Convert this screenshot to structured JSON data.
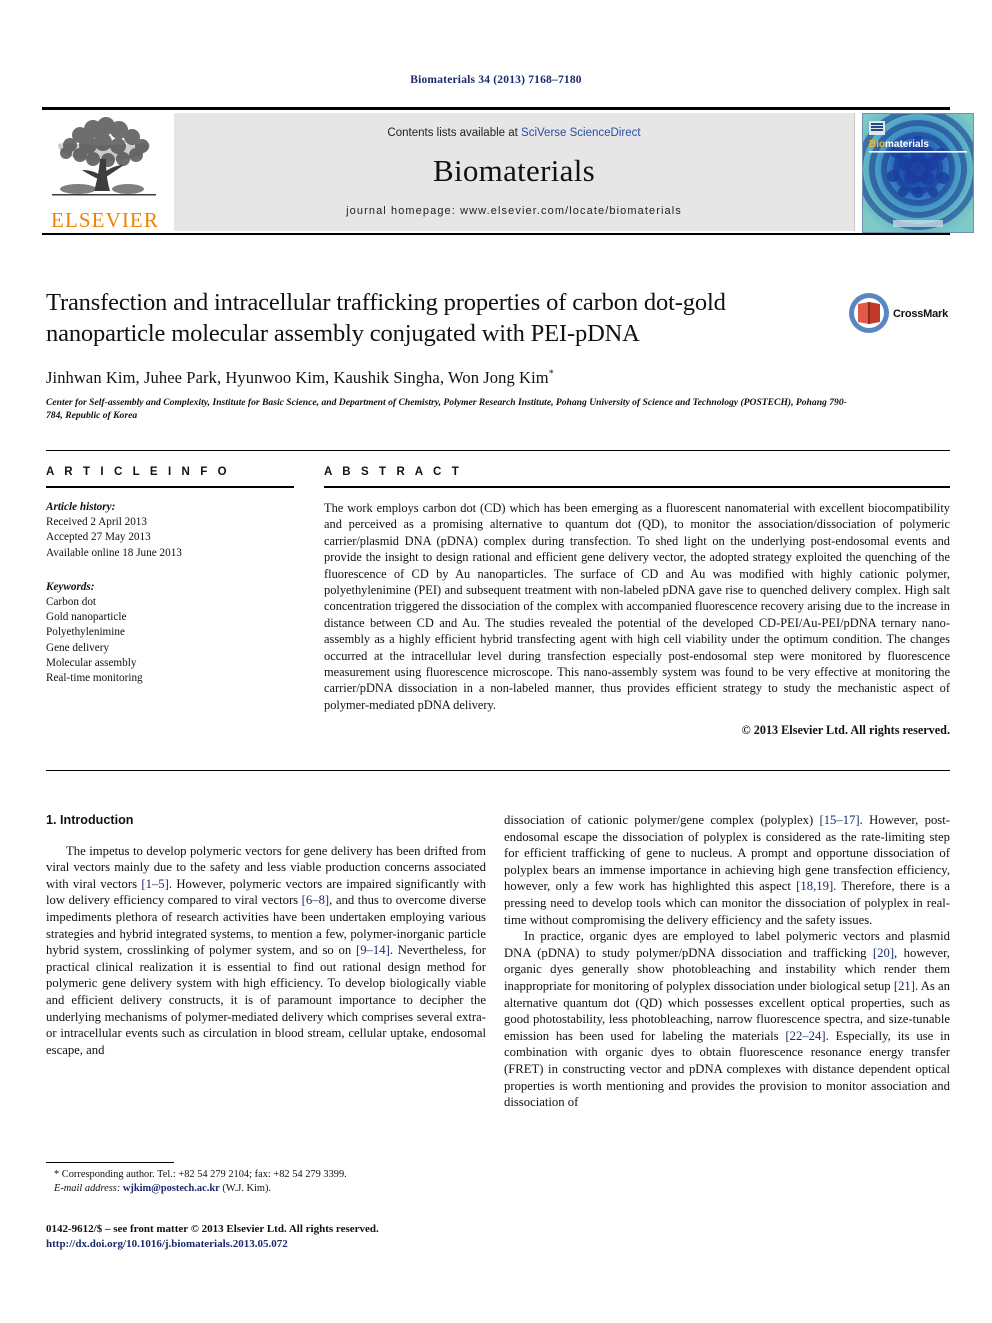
{
  "running_head": "Biomaterials 34 (2013) 7168–7180",
  "masthead": {
    "publisher_name": "ELSEVIER",
    "contents_prefix": "Contents lists available at ",
    "contents_link": "SciVerse ScienceDirect",
    "journal_title": "Biomaterials",
    "homepage": "journal homepage: www.elsevier.com/locate/biomaterials",
    "cover_title_bold": "Bio",
    "cover_title_rest": "materials"
  },
  "article": {
    "title": "Transfection and intracellular trafficking properties of carbon dot-gold nanoparticle molecular assembly conjugated with PEI-pDNA",
    "authors": "Jinhwan Kim, Juhee Park, Hyunwoo Kim, Kaushik Singha, Won Jong Kim",
    "author_marker": "*",
    "affiliation": "Center for Self-assembly and Complexity, Institute for Basic Science, and Department of Chemistry, Polymer Research Institute, Pohang University of Science and Technology (POSTECH), Pohang 790-784, Republic of Korea",
    "crossmark_label": "CrossMark"
  },
  "article_info": {
    "heading": "A R T I C L E  I N F O",
    "history_label": "Article history:",
    "history": [
      "Received 2 April 2013",
      "Accepted 27 May 2013",
      "Available online 18 June 2013"
    ],
    "keywords_label": "Keywords:",
    "keywords": [
      "Carbon dot",
      "Gold nanoparticle",
      "Polyethylenimine",
      "Gene delivery",
      "Molecular assembly",
      "Real-time monitoring"
    ]
  },
  "abstract": {
    "heading": "A B S T R A C T",
    "text": "The work employs carbon dot (CD) which has been emerging as a fluorescent nanomaterial with excellent biocompatibility and perceived as a promising alternative to quantum dot (QD), to monitor the association/dissociation of polymeric carrier/plasmid DNA (pDNA) complex during transfection. To shed light on the underlying post-endosomal events and provide the insight to design rational and efficient gene delivery vector, the adopted strategy exploited the quenching of the fluorescence of CD by Au nanoparticles. The surface of CD and Au was modified with highly cationic polymer, polyethylenimine (PEI) and subsequent treatment with non-labeled pDNA gave rise to quenched delivery complex. High salt concentration triggered the dissociation of the complex with accompanied fluorescence recovery arising due to the increase in distance between CD and Au. The studies revealed the potential of the developed CD-PEI/Au-PEI/pDNA ternary nano-assembly as a highly efficient hybrid transfecting agent with high cell viability under the optimum condition. The changes occurred at the intracellular level during transfection especially post-endosomal step were monitored by fluorescence measurement using fluorescence microscope. This nano-assembly system was found to be very effective at monitoring the carrier/pDNA dissociation in a non-labeled manner, thus provides efficient strategy to study the mechanistic aspect of polymer-mediated pDNA delivery.",
    "copyright": "© 2013 Elsevier Ltd. All rights reserved."
  },
  "introduction": {
    "heading": "1. Introduction",
    "left_paragraphs": [
      {
        "segments": [
          {
            "t": "The impetus to develop polymeric vectors for gene delivery has been drifted from viral vectors mainly due to the safety and less viable production concerns associated with viral vectors "
          },
          {
            "t": "[1–5]",
            "ref": true
          },
          {
            "t": ". However, polymeric vectors are impaired significantly with low delivery efficiency compared to viral vectors "
          },
          {
            "t": "[6–8]",
            "ref": true
          },
          {
            "t": ", and thus to overcome diverse impediments plethora of research activities have been undertaken employing various strategies and hybrid integrated systems, to mention a few, polymer-inorganic particle hybrid system, crosslinking of polymer system, and so on "
          },
          {
            "t": "[9–14]",
            "ref": true
          },
          {
            "t": ". Nevertheless, for practical clinical realization it is essential to find out rational design method for polymeric gene delivery system with high efficiency. To develop biologically viable and efficient delivery constructs, it is of paramount importance to decipher the underlying mechanisms of polymer-mediated delivery which comprises several extra- or intracellular events such as circulation in blood stream, cellular uptake, endosomal escape, and"
          }
        ]
      }
    ],
    "right_paragraphs": [
      {
        "indent": false,
        "segments": [
          {
            "t": "dissociation of cationic polymer/gene complex (polyplex) "
          },
          {
            "t": "[15–17]",
            "ref": true
          },
          {
            "t": ". However, post-endosomal escape the dissociation of polyplex is considered as the rate-limiting step for efficient trafficking of gene to nucleus. A prompt and opportune dissociation of polyplex bears an immense importance in achieving high gene transfection efficiency, however, only a few work has highlighted this aspect "
          },
          {
            "t": "[18,19]",
            "ref": true
          },
          {
            "t": ". Therefore, there is a pressing need to develop tools which can monitor the dissociation of polyplex in real-time without compromising the delivery efficiency and the safety issues."
          }
        ]
      },
      {
        "indent": true,
        "segments": [
          {
            "t": "In practice, organic dyes are employed to label polymeric vectors and plasmid DNA (pDNA) to study polymer/pDNA dissociation and trafficking "
          },
          {
            "t": "[20]",
            "ref": true
          },
          {
            "t": ", however, organic dyes generally show photobleaching and instability which render them inappropriate for monitoring of polyplex dissociation under biological setup "
          },
          {
            "t": "[21]",
            "ref": true
          },
          {
            "t": ". As an alternative quantum dot (QD) which possesses excellent optical properties, such as good photostability, less photobleaching, narrow fluorescence spectra, and size-tunable emission has been used for labeling the materials "
          },
          {
            "t": "[22–24]",
            "ref": true
          },
          {
            "t": ". Especially, its use in combination with organic dyes to obtain fluorescence resonance energy transfer (FRET) in constructing vector and pDNA complexes with distance dependent optical properties is worth mentioning and provides the provision to monitor association and dissociation of"
          }
        ]
      }
    ]
  },
  "footnote": {
    "corresponding": "* Corresponding author. Tel.: +82 54 279 2104; fax: +82 54 279 3399.",
    "email_label": "E-mail address:",
    "email": "wjkim@postech.ac.kr",
    "email_suffix": "(W.J. Kim)."
  },
  "colophon": {
    "issn_line": "0142-9612/$ – see front matter © 2013 Elsevier Ltd. All rights reserved.",
    "doi": "http://dx.doi.org/10.1016/j.biomaterials.2013.05.072"
  },
  "colors": {
    "link_blue": "#2a4ea2",
    "ref_blue": "#1a2a6b",
    "elsevier_orange": "#ef8200",
    "band_gray": "#e6e6e6"
  }
}
